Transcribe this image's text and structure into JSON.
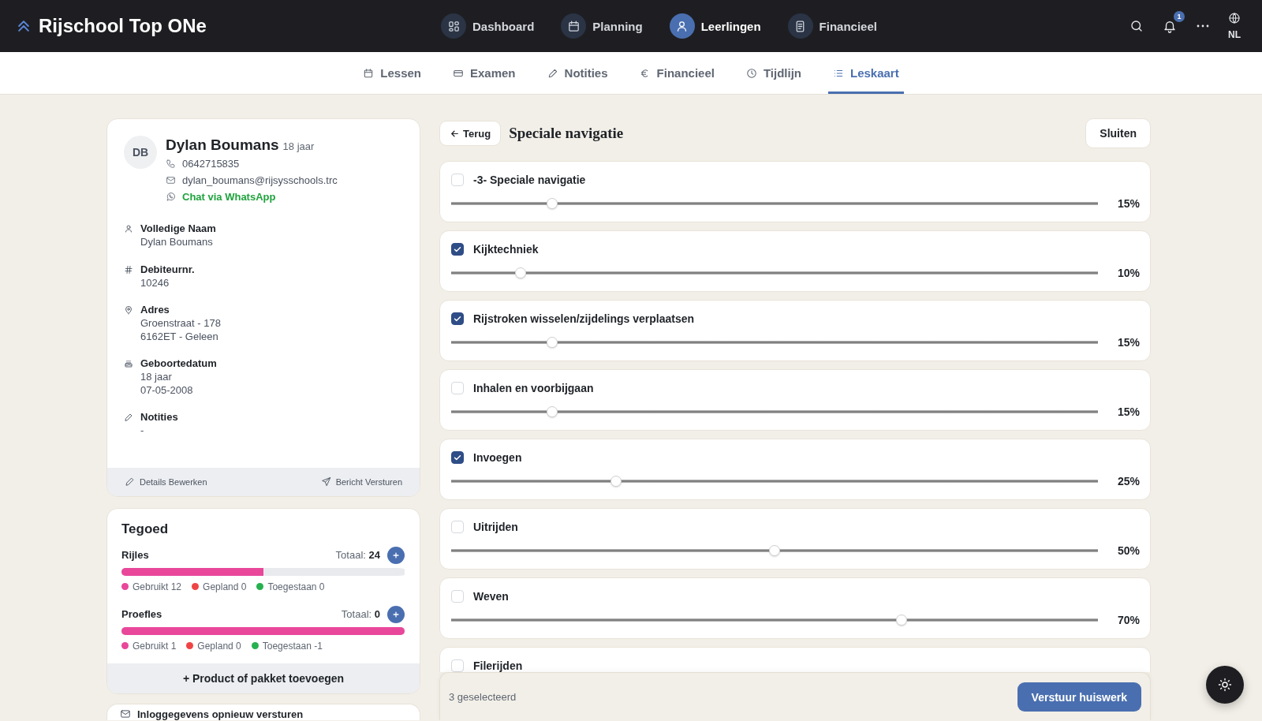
{
  "app_bar": {
    "title": "Rijschool Top ONe",
    "nav": [
      {
        "label": "Dashboard",
        "selected": false
      },
      {
        "label": "Planning",
        "selected": false
      },
      {
        "label": "Leerlingen",
        "selected": true
      },
      {
        "label": "Financieel",
        "selected": false
      }
    ],
    "notification_count": "1",
    "language": "NL"
  },
  "tabs": [
    {
      "label": "Lessen",
      "selected": false
    },
    {
      "label": "Examen",
      "selected": false
    },
    {
      "label": "Notities",
      "selected": false
    },
    {
      "label": "Financieel",
      "selected": false
    },
    {
      "label": "Tijdlijn",
      "selected": false
    },
    {
      "label": "Leskaart",
      "selected": true
    }
  ],
  "student": {
    "initials": "DB",
    "name": "Dylan Boumans",
    "age": "18 jaar",
    "phone": "0642715835",
    "email": "dylan_boumans@rijsysschools.trc",
    "whatsapp": "Chat via WhatsApp",
    "fields": [
      {
        "label": "Volledige Naam",
        "lines": [
          "Dylan Boumans"
        ]
      },
      {
        "label": "Debiteurnr.",
        "lines": [
          "10246"
        ]
      },
      {
        "label": "Adres",
        "lines": [
          "Groenstraat - 178",
          "6162ET - Geleen"
        ]
      },
      {
        "label": "Geboortedatum",
        "lines": [
          "18 jaar",
          "07-05-2008"
        ]
      },
      {
        "label": "Notities",
        "lines": [
          "-"
        ]
      }
    ],
    "actions": [
      "Details Bewerken",
      "Bericht Versturen"
    ]
  },
  "credit": {
    "title": "Tegoed",
    "items": [
      {
        "name": "Rijles",
        "total": "Totaal: **24**",
        "level": 0.5,
        "legend": [
          {
            "label": "Gebruikt 12",
            "color": "#e8479a"
          },
          {
            "label": "Gepland 0",
            "color": "#ef4444"
          },
          {
            "label": "Toegestaan 0",
            "color": "#27b04f"
          }
        ]
      },
      {
        "name": "Proefles",
        "total": "Totaal: **0**",
        "level": 1,
        "legend": [
          {
            "label": "Gebruikt 1",
            "color": "#e8479a"
          },
          {
            "label": "Gepland 0",
            "color": "#ef4444"
          },
          {
            "label": "Toegestaan -1",
            "color": "#27b04f"
          }
        ]
      }
    ],
    "add_product": "+ Product of pakket toevoegen"
  },
  "resend_login": {
    "label": "Inloggegevens opnieuw versturen"
  },
  "panel": {
    "back": "Terug",
    "title": "Speciale navigatie",
    "close": "Sluiten",
    "skills": [
      {
        "label": "-3- Speciale navigatie",
        "checked": false,
        "level": 0.15,
        "reading": "15%"
      },
      {
        "label": "Kijktechniek",
        "checked": true,
        "level": 0.1,
        "reading": "10%"
      },
      {
        "label": "Rijstroken wisselen/zijdelings verplaatsen",
        "checked": true,
        "level": 0.15,
        "reading": "15%"
      },
      {
        "label": "Inhalen en voorbijgaan",
        "checked": false,
        "level": 0.15,
        "reading": "15%"
      },
      {
        "label": "Invoegen",
        "checked": true,
        "level": 0.25,
        "reading": "25%"
      },
      {
        "label": "Uitrijden",
        "checked": false,
        "level": 0.5,
        "reading": "50%"
      },
      {
        "label": "Weven",
        "checked": false,
        "level": 0.7,
        "reading": "70%"
      },
      {
        "label": "Filerijden",
        "checked": false
      }
    ],
    "footer": {
      "selection": "3 geselecteerd",
      "submit": "Verstuur huiswerk"
    }
  }
}
